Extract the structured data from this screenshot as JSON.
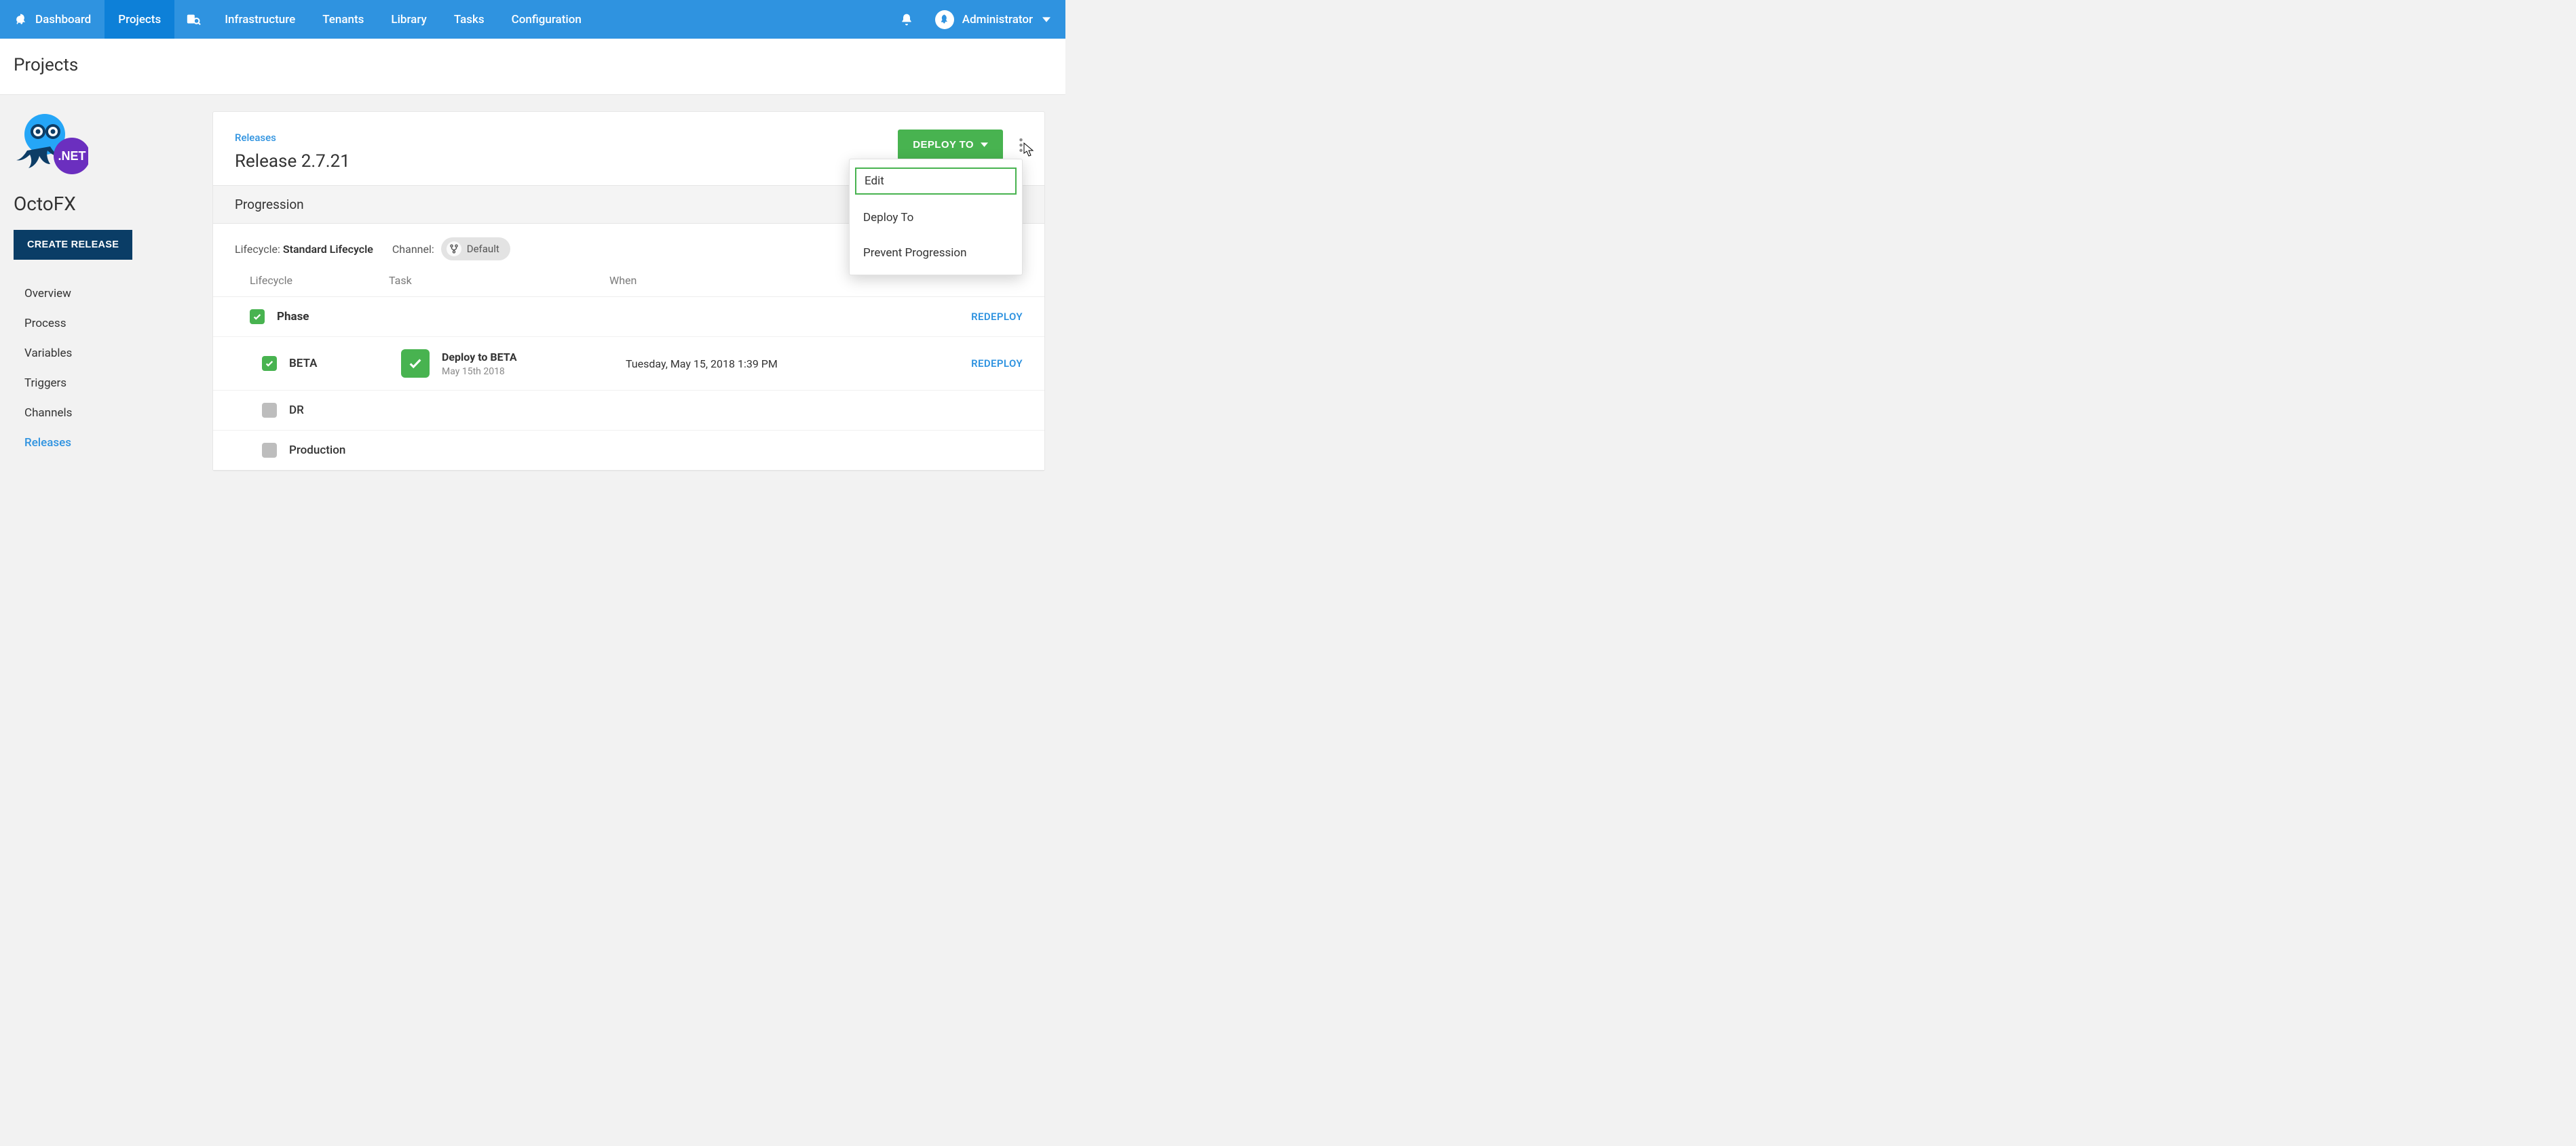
{
  "nav": {
    "items": [
      {
        "label": "Dashboard",
        "icon": "octo"
      },
      {
        "label": "Projects",
        "active": true
      },
      {
        "label": "",
        "icon": "search"
      },
      {
        "label": "Infrastructure"
      },
      {
        "label": "Tenants"
      },
      {
        "label": "Library"
      },
      {
        "label": "Tasks"
      },
      {
        "label": "Configuration"
      }
    ],
    "user": "Administrator"
  },
  "page_title": "Projects",
  "sidebar": {
    "project_name": "OctoFX",
    "logo_badge": ".NET",
    "create_btn": "CREATE RELEASE",
    "items": [
      {
        "label": "Overview"
      },
      {
        "label": "Process"
      },
      {
        "label": "Variables"
      },
      {
        "label": "Triggers"
      },
      {
        "label": "Channels"
      },
      {
        "label": "Releases",
        "active": true
      }
    ]
  },
  "release": {
    "breadcrumb": "Releases",
    "title": "Release 2.7.21",
    "deploy_btn": "DEPLOY TO",
    "overflow_menu": [
      {
        "label": "Edit",
        "highlight": true
      },
      {
        "label": "Deploy To"
      },
      {
        "label": "Prevent Progression"
      }
    ]
  },
  "progression": {
    "title": "Progression",
    "lifecycle_label": "Lifecycle:",
    "lifecycle_value": "Standard Lifecycle",
    "channel_label": "Channel:",
    "channel_value": "Default",
    "columns": {
      "lifecycle": "Lifecycle",
      "task": "Task",
      "when": "When"
    },
    "phase_label": "Phase",
    "redeploy_label": "REDEPLOY",
    "rows": [
      {
        "env": "BETA",
        "status": "green",
        "task_title": "Deploy to BETA",
        "task_sub": "May 15th 2018",
        "when": "Tuesday, May 15, 2018 1:39 PM",
        "redeploy": true
      },
      {
        "env": "DR",
        "status": "grey"
      },
      {
        "env": "Production",
        "status": "grey"
      }
    ]
  }
}
